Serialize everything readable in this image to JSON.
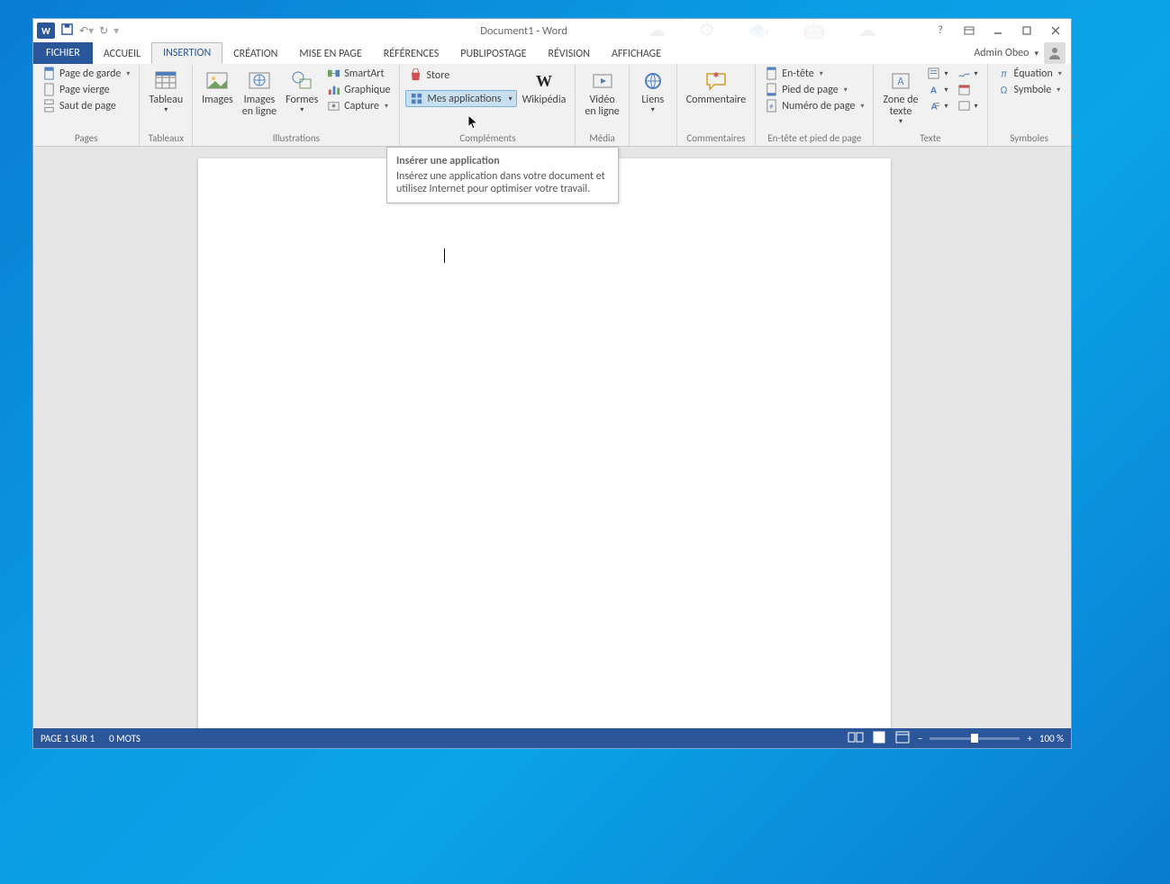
{
  "window": {
    "title": "Document1 - Word"
  },
  "qat": {
    "undo": "↶",
    "redo": "↷"
  },
  "tabs": {
    "file": "FICHIER",
    "items": [
      "ACCUEIL",
      "INSERTION",
      "CRÉATION",
      "MISE EN PAGE",
      "RÉFÉRENCES",
      "PUBLIPOSTAGE",
      "RÉVISION",
      "AFFICHAGE"
    ],
    "active_index": 1
  },
  "user": {
    "name": "Admin Obeo"
  },
  "ribbon": {
    "pages": {
      "label": "Pages",
      "cover": "Page de garde",
      "blank": "Page vierge",
      "break": "Saut de page"
    },
    "tables": {
      "label": "Tableaux",
      "table": "Tableau"
    },
    "illus": {
      "label": "Illustrations",
      "images": "Images",
      "imagesOnline": "Images\nen ligne",
      "shapes": "Formes",
      "smartart": "SmartArt",
      "chart": "Graphique",
      "capture": "Capture"
    },
    "addins": {
      "label": "Compléments",
      "store": "Store",
      "myapps": "Mes applications",
      "wiki": "Wikipédia"
    },
    "media": {
      "label": "Média",
      "video": "Vidéo\nen ligne"
    },
    "links": {
      "label": "",
      "link": "Liens"
    },
    "comments": {
      "label": "Commentaires",
      "comment": "Commentaire"
    },
    "headerfooter": {
      "label": "En-tête et pied de page",
      "header": "En-tête",
      "footer": "Pied de page",
      "pagenum": "Numéro de page"
    },
    "text": {
      "label": "Texte",
      "textbox": "Zone de\ntexte"
    },
    "symbols": {
      "label": "Symboles",
      "equation": "Équation",
      "symbol": "Symbole"
    }
  },
  "tooltip": {
    "title": "Insérer une application",
    "body": "Insérez une application dans votre document et utilisez Internet pour optimiser votre travail."
  },
  "status": {
    "page": "PAGE 1 SUR 1",
    "words": "0 MOTS",
    "zoom": "100 %"
  }
}
